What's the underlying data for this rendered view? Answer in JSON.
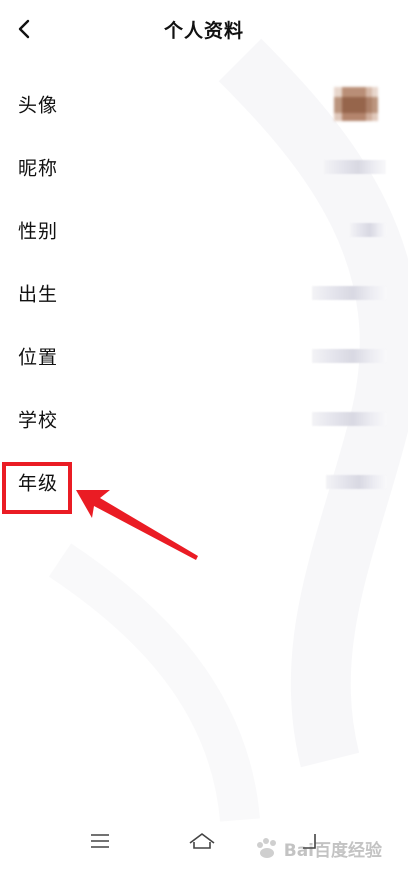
{
  "header": {
    "back_icon": "chevron-left-icon",
    "title": "个人资料"
  },
  "rows": [
    {
      "label": "头像"
    },
    {
      "label": "昵称"
    },
    {
      "label": "性别"
    },
    {
      "label": "出生"
    },
    {
      "label": "位置"
    },
    {
      "label": "学校"
    },
    {
      "label": "年级"
    }
  ],
  "annotation": {
    "highlight_color": "#ea1c24"
  },
  "bottom_nav": {
    "icons": [
      "menu-icon",
      "home-icon",
      "back-icon"
    ]
  },
  "watermark": {
    "text": "Bai百度经验"
  }
}
